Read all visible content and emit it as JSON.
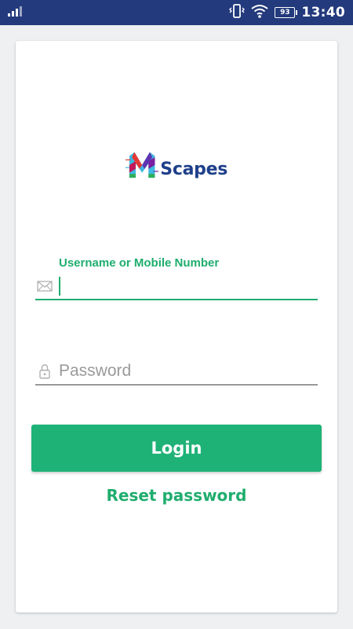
{
  "status_bar": {
    "time": "13:40",
    "battery_level": "93",
    "icons": [
      "signal-icon",
      "vibrate-icon",
      "wifi-icon",
      "battery-icon"
    ]
  },
  "logo": {
    "text": "Scapes",
    "letter": "M"
  },
  "login_form": {
    "username_label": "Username or Mobile Number",
    "username_value": "",
    "password_placeholder": "Password",
    "password_value": "",
    "login_label": "Login",
    "reset_label": "Reset password"
  },
  "colors": {
    "accent": "#1fb277",
    "status_bar": "#233a7c",
    "brand_text": "#1e3f8a"
  }
}
